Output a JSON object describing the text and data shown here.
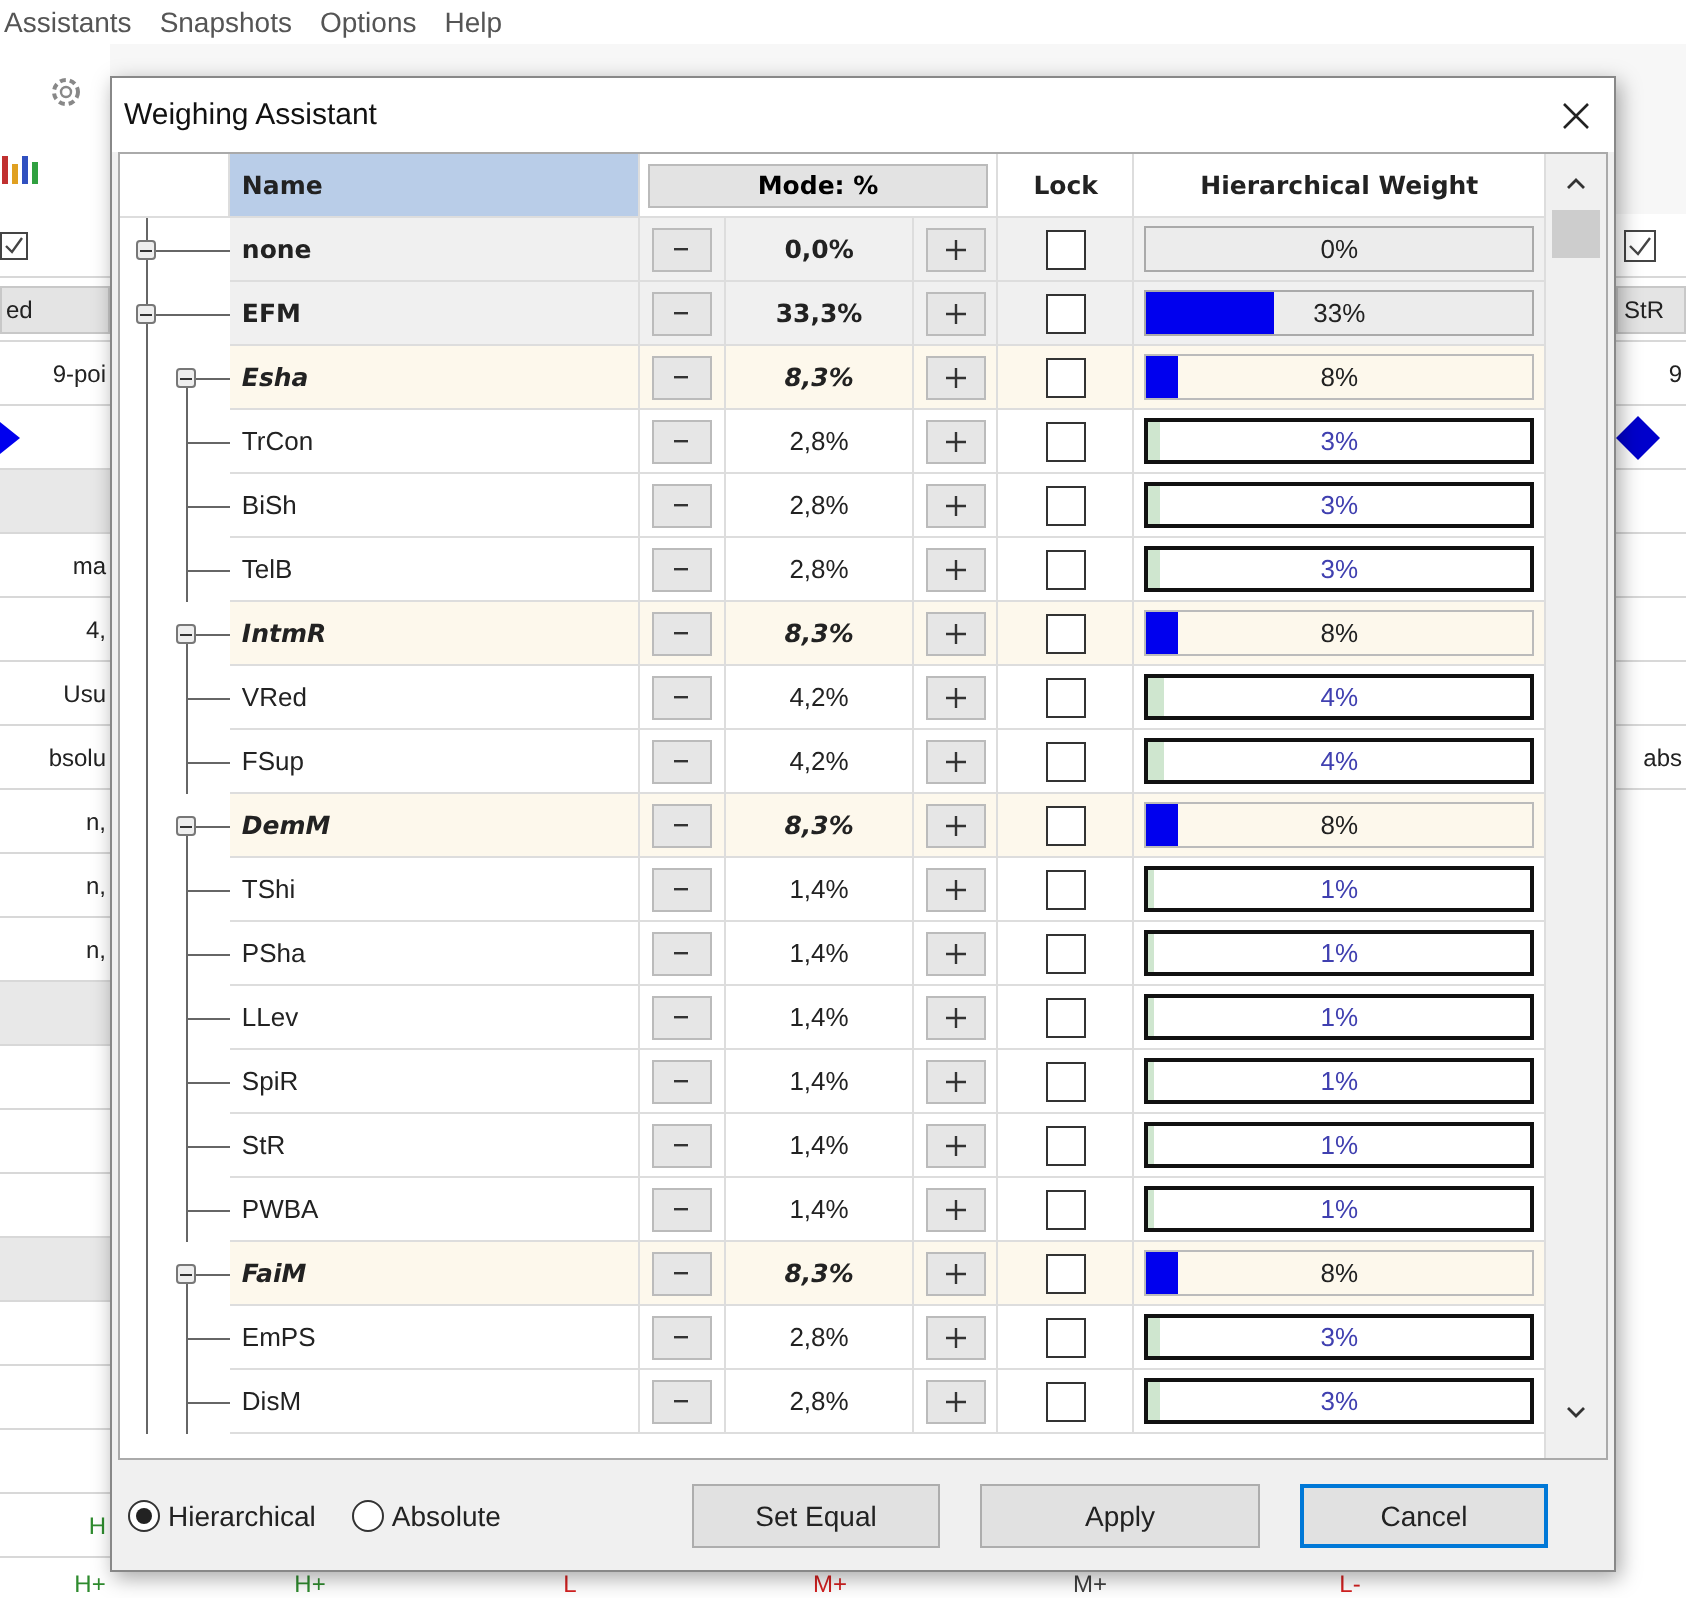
{
  "menu": [
    "Assistants",
    "Snapshots",
    "Options",
    "Help"
  ],
  "background": {
    "left_cells": [
      {
        "kind": "checkbox",
        "checked": true
      },
      {
        "kind": "header",
        "text": "ed"
      },
      {
        "kind": "text",
        "text": "9-poi"
      },
      {
        "kind": "triangle-marker"
      },
      {
        "kind": "gray"
      },
      {
        "kind": "text",
        "text": "ma"
      },
      {
        "kind": "text",
        "text": "4,"
      },
      {
        "kind": "text",
        "text": "Usu"
      },
      {
        "kind": "text",
        "text": "bsolu"
      },
      {
        "kind": "text",
        "text": "n,"
      },
      {
        "kind": "text",
        "text": "n,"
      },
      {
        "kind": "text",
        "text": "n,"
      },
      {
        "kind": "gray"
      },
      {
        "kind": "empty"
      },
      {
        "kind": "empty"
      },
      {
        "kind": "empty"
      },
      {
        "kind": "gray"
      },
      {
        "kind": "empty"
      },
      {
        "kind": "empty"
      },
      {
        "kind": "empty"
      },
      {
        "kind": "text",
        "text": "H",
        "color": "#2e8b2e"
      }
    ],
    "right_cells": [
      {
        "kind": "checkbox",
        "checked": true
      },
      {
        "kind": "header",
        "text": "StR"
      },
      {
        "kind": "text",
        "text": "9"
      },
      {
        "kind": "diamond-marker"
      },
      {
        "kind": "empty"
      },
      {
        "kind": "empty"
      },
      {
        "kind": "empty"
      },
      {
        "kind": "empty"
      },
      {
        "kind": "text",
        "text": "abs"
      }
    ],
    "bottom_cells": [
      {
        "text": "H+",
        "color": "#2e8b2e"
      },
      {
        "text": "H+",
        "color": "#2e8b2e"
      },
      {
        "text": "L",
        "color": "#d42020"
      },
      {
        "text": "M+",
        "color": "#d42020"
      },
      {
        "text": "M+",
        "color": "#404040"
      },
      {
        "text": "L-",
        "color": "#d42020"
      }
    ]
  },
  "dialog": {
    "title": "Weighing Assistant",
    "table": {
      "columns": {
        "name": "Name",
        "mode": "Mode: %",
        "lock": "Lock",
        "weight": "Hierarchical Weight"
      },
      "rows": [
        {
          "name": "none",
          "kind": "root",
          "expanded": true,
          "value": "0,0%",
          "locked": false,
          "weight": "0%"
        },
        {
          "name": "EFM",
          "kind": "root",
          "expanded": true,
          "value": "33,3%",
          "locked": false,
          "weight": "33%",
          "level": 0.333,
          "children": [
            {
              "name": "Esha",
              "kind": "group",
              "expanded": true,
              "value": "8,3%",
              "locked": false,
              "weight": "8%",
              "level": 0.083,
              "children": [
                {
                  "name": "TrCon",
                  "kind": "leaf",
                  "value": "2,8%",
                  "locked": false,
                  "weight": "3%",
                  "level": 0.028
                },
                {
                  "name": "BiSh",
                  "kind": "leaf",
                  "value": "2,8%",
                  "locked": false,
                  "weight": "3%",
                  "level": 0.028
                },
                {
                  "name": "TelB",
                  "kind": "leaf",
                  "value": "2,8%",
                  "locked": false,
                  "weight": "3%",
                  "level": 0.028
                }
              ]
            },
            {
              "name": "IntmR",
              "kind": "group",
              "expanded": true,
              "value": "8,3%",
              "locked": false,
              "weight": "8%",
              "level": 0.083,
              "children": [
                {
                  "name": "VRed",
                  "kind": "leaf",
                  "value": "4,2%",
                  "locked": false,
                  "weight": "4%",
                  "level": 0.042
                },
                {
                  "name": "FSup",
                  "kind": "leaf",
                  "value": "4,2%",
                  "locked": false,
                  "weight": "4%",
                  "level": 0.042
                }
              ]
            },
            {
              "name": "DemM",
              "kind": "group",
              "expanded": true,
              "value": "8,3%",
              "locked": false,
              "weight": "8%",
              "level": 0.083,
              "children": [
                {
                  "name": "TShi",
                  "kind": "leaf",
                  "value": "1,4%",
                  "locked": false,
                  "weight": "1%",
                  "level": 0.014
                },
                {
                  "name": "PSha",
                  "kind": "leaf",
                  "value": "1,4%",
                  "locked": false,
                  "weight": "1%",
                  "level": 0.014
                },
                {
                  "name": "LLev",
                  "kind": "leaf",
                  "value": "1,4%",
                  "locked": false,
                  "weight": "1%",
                  "level": 0.014
                },
                {
                  "name": "SpiR",
                  "kind": "leaf",
                  "value": "1,4%",
                  "locked": false,
                  "weight": "1%",
                  "level": 0.014
                },
                {
                  "name": "StR",
                  "kind": "leaf",
                  "value": "1,4%",
                  "locked": false,
                  "weight": "1%",
                  "level": 0.014
                },
                {
                  "name": "PWBA",
                  "kind": "leaf",
                  "value": "1,4%",
                  "locked": false,
                  "weight": "1%",
                  "level": 0.014
                }
              ]
            },
            {
              "name": "FaiM",
              "kind": "group",
              "expanded": true,
              "value": "8,3%",
              "locked": false,
              "weight": "8%",
              "level": 0.083,
              "children": [
                {
                  "name": "EmPS",
                  "kind": "leaf",
                  "value": "2,8%",
                  "locked": false,
                  "weight": "3%",
                  "level": 0.028
                },
                {
                  "name": "DisM",
                  "kind": "leaf",
                  "value": "2,8%",
                  "locked": false,
                  "weight": "3%",
                  "level": 0.028
                }
              ]
            }
          ]
        }
      ]
    },
    "modes": [
      {
        "label": "Hierarchical",
        "selected": true
      },
      {
        "label": "Absolute",
        "selected": false
      }
    ],
    "buttons": [
      {
        "label": "Set Equal",
        "default": false
      },
      {
        "label": "Apply",
        "default": false
      },
      {
        "label": "Cancel",
        "default": true
      }
    ]
  }
}
